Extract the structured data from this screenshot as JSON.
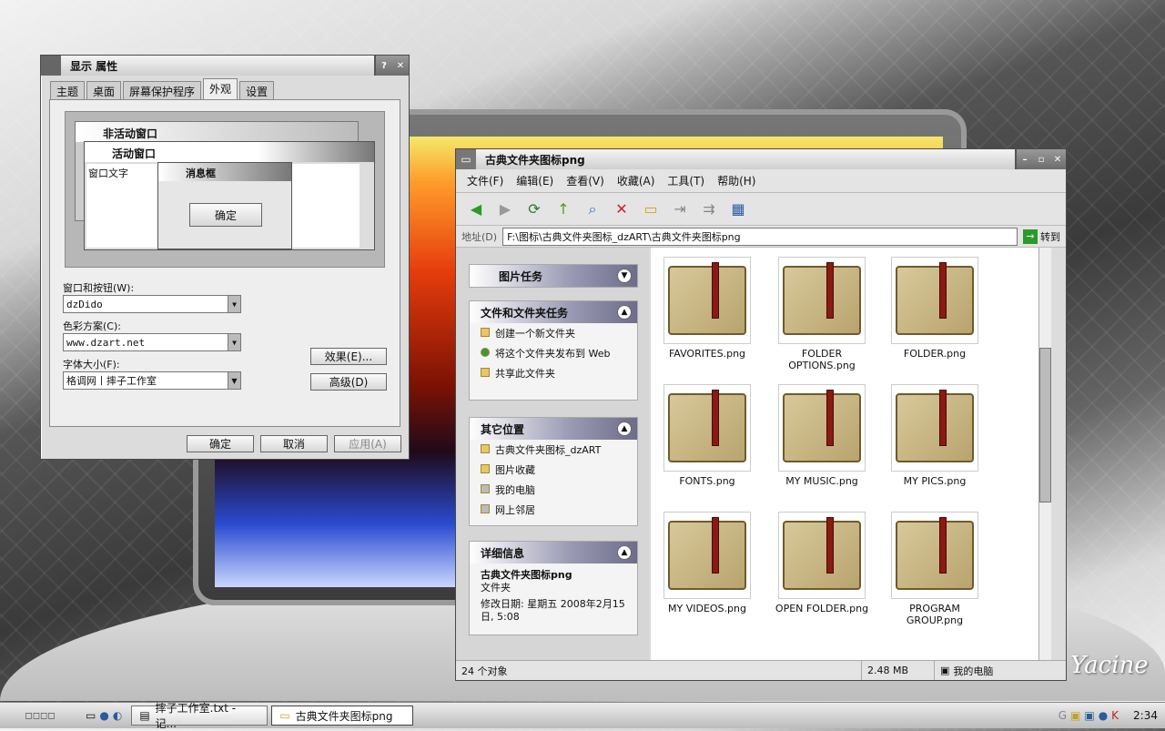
{
  "display_props": {
    "title": "显示 属性",
    "tabs": [
      "主题",
      "桌面",
      "屏幕保护程序",
      "外观",
      "设置"
    ],
    "active_tab": "外观",
    "preview": {
      "inactive": "非活动窗口",
      "active": "活动窗口",
      "window_text": "窗口文字",
      "msgbox": "消息框",
      "ok": "确定"
    },
    "windows_buttons_label": "窗口和按钮(W):",
    "windows_buttons_value": "dzDido",
    "color_scheme_label": "色彩方案(C):",
    "color_scheme_value": "www.dzart.net",
    "font_size_label": "字体大小(F):",
    "font_size_value": "格调网丨摔子工作室",
    "effects_btn": "效果(E)...",
    "advanced_btn": "高级(D)",
    "ok_btn": "确定",
    "cancel_btn": "取消",
    "apply_btn": "应用(A)"
  },
  "explorer": {
    "title": "古典文件夹图标png",
    "menu": [
      "文件(F)",
      "编辑(E)",
      "查看(V)",
      "收藏(A)",
      "工具(T)",
      "帮助(H)"
    ],
    "address_label": "地址(D)",
    "address_value": "F:\\图标\\古典文件夹图标_dzART\\古典文件夹图标png",
    "go_label": "转到",
    "tasks": {
      "picture_tasks": "图片任务",
      "file_tasks": "文件和文件夹任务",
      "file_items": [
        "创建一个新文件夹",
        "将这个文件夹发布到 Web",
        "共享此文件夹"
      ],
      "other_places": "其它位置",
      "other_items": [
        "古典文件夹图标_dzART",
        "图片收藏",
        "我的电脑",
        "网上邻居"
      ],
      "details": "详细信息",
      "details_name": "古典文件夹图标png",
      "details_type": "文件夹",
      "details_date": "修改日期: 星期五 2008年2月15日, 5:08"
    },
    "files": [
      "FAVORITES.png",
      "FOLDER OPTIONS.png",
      "FOLDER.png",
      "FONTS.png",
      "MY MUSIC.png",
      "MY PICS.png",
      "MY VIDEOS.png",
      "OPEN FOLDER.png",
      "PROGRAM GROUP.png"
    ],
    "status": {
      "count": "24 个对象",
      "size": "2.48 MB",
      "location": "我的电脑"
    }
  },
  "taskbar": {
    "item1": "摔子工作室.txt - 记...",
    "item2": "古典文件夹图标png",
    "clock": "2:34"
  },
  "signature": "Yacine"
}
